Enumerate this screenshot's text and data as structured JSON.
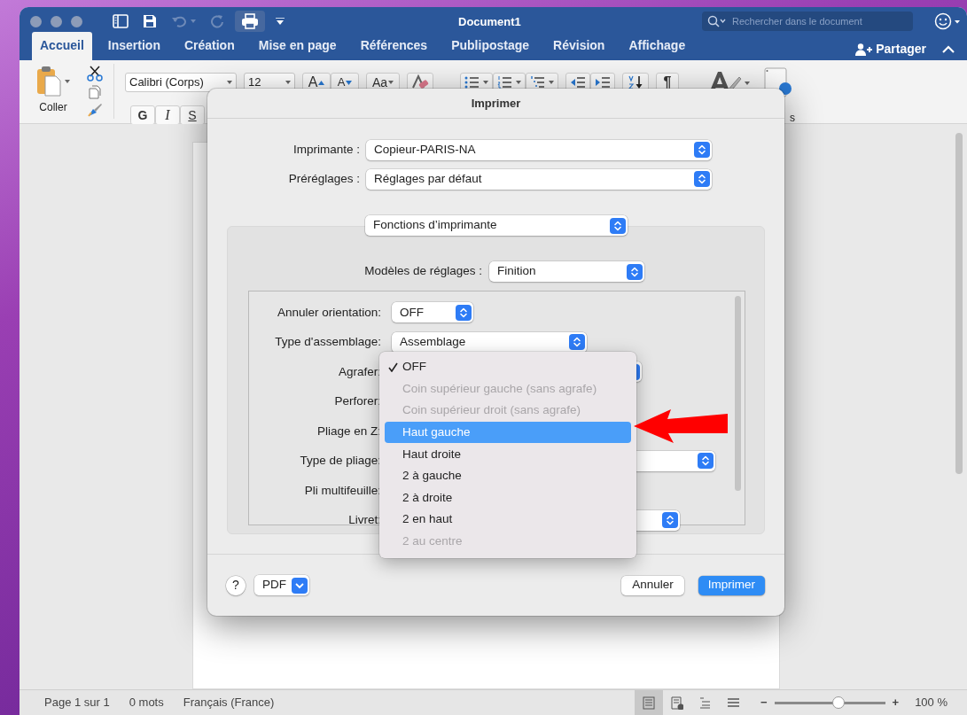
{
  "window": {
    "title": "Document1"
  },
  "title_bar": {
    "search": {
      "placeholder": "Rechercher dans le document"
    }
  },
  "ribbon_tabs": [
    {
      "label": "Accueil",
      "selected": true
    },
    {
      "label": "Insertion",
      "selected": false
    },
    {
      "label": "Création",
      "selected": false
    },
    {
      "label": "Mise en page",
      "selected": false
    },
    {
      "label": "Références",
      "selected": false
    },
    {
      "label": "Publipostage",
      "selected": false
    },
    {
      "label": "Révision",
      "selected": false
    },
    {
      "label": "Affichage",
      "selected": false
    }
  ],
  "share": {
    "label": "Partager"
  },
  "ribbon": {
    "paste": {
      "label": "Coller"
    },
    "font_name": "Calibri (Corps)",
    "font_size": "12",
    "size_buttons": [
      {
        "label": "A",
        "kind": "grow"
      },
      {
        "label": "A",
        "kind": "shrink"
      }
    ],
    "case_button": "Aa",
    "format_buttons": [
      {
        "label": "G",
        "kind": "bold"
      },
      {
        "label": "I",
        "kind": "italic"
      },
      {
        "label": "S",
        "kind": "underline"
      }
    ],
    "pilcrow": "¶",
    "hidden_label_tail": "s"
  },
  "print_dialog": {
    "title": "Imprimer",
    "printer": {
      "label": "Imprimante :",
      "value": "Copieur-PARIS-NA"
    },
    "presets": {
      "label": "Préréglages :",
      "value": "Réglages par défaut"
    },
    "section": "Fonctions d’imprimante",
    "feature_sets": {
      "label": "Modèles de réglages :",
      "value": "Finition"
    },
    "settings": [
      {
        "label": "Annuler orientation:",
        "kind": "popup",
        "value": "OFF"
      },
      {
        "label": "Type d'assemblage:",
        "kind": "popup",
        "value": "Assemblage"
      },
      {
        "label": "Agrafer:",
        "kind": "popup"
      },
      {
        "label": "Perforer:",
        "kind": "covered"
      },
      {
        "label": "Pliage en Z:",
        "kind": "covered"
      },
      {
        "label": "Type de pliage:",
        "kind": "popup"
      },
      {
        "label": "Pli multifeuille:",
        "kind": "covered"
      },
      {
        "label": "Livret:",
        "kind": "popup"
      }
    ],
    "help": "?",
    "pdf": "PDF",
    "buttons": [
      {
        "label": "Annuler",
        "kind": "secondary"
      },
      {
        "label": "Imprimer",
        "kind": "primary"
      }
    ]
  },
  "stapling_menu": {
    "items": [
      {
        "label": "OFF",
        "checked": true,
        "disabled": false,
        "selected": false
      },
      {
        "label": "Coin supérieur gauche (sans agrafe)",
        "checked": false,
        "disabled": true,
        "selected": false
      },
      {
        "label": "Coin supérieur droit (sans agrafe)",
        "checked": false,
        "disabled": true,
        "selected": false
      },
      {
        "label": "Haut gauche",
        "checked": false,
        "disabled": false,
        "selected": true
      },
      {
        "label": "Haut droite",
        "checked": false,
        "disabled": false,
        "selected": false
      },
      {
        "label": "2 à gauche",
        "checked": false,
        "disabled": false,
        "selected": false
      },
      {
        "label": "2 à droite",
        "checked": false,
        "disabled": false,
        "selected": false
      },
      {
        "label": "2 en haut",
        "checked": false,
        "disabled": false,
        "selected": false
      },
      {
        "label": "2 au centre",
        "checked": false,
        "disabled": true,
        "selected": false
      }
    ]
  },
  "status_bar": {
    "page": "Page 1 sur 1",
    "words": "0 mots",
    "language": "Français (France)",
    "views": [
      {
        "selected": true
      },
      {
        "selected": false
      },
      {
        "selected": false
      },
      {
        "selected": false
      }
    ],
    "zoom_out": "−",
    "zoom_in": "+",
    "zoom": {
      "level": 0.58
    },
    "zoom_reading": "100 %"
  }
}
